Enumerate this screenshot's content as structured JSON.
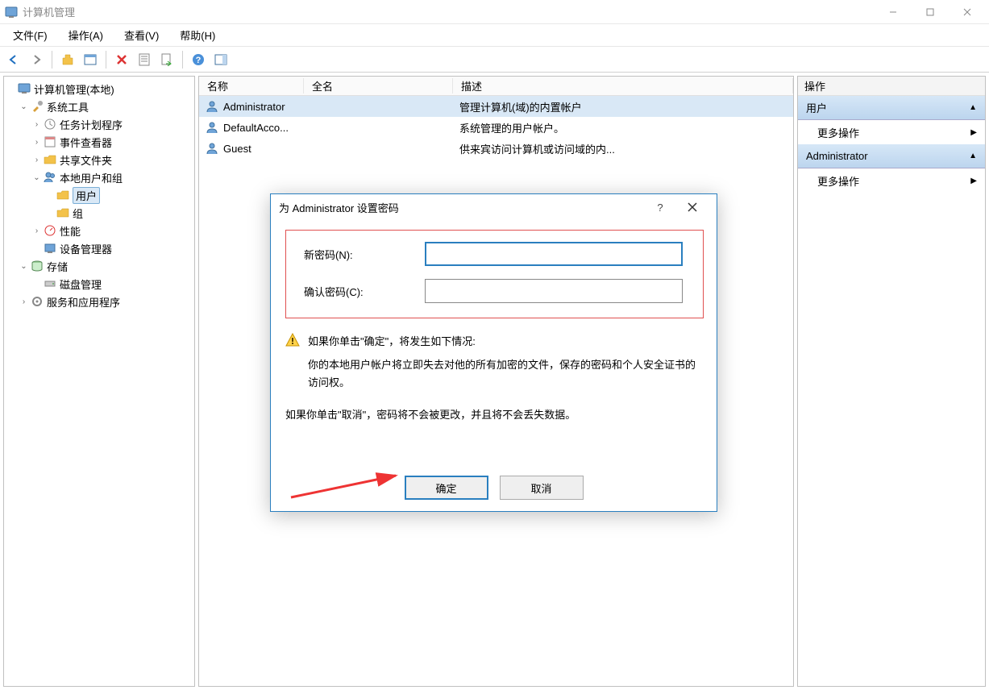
{
  "window": {
    "title": "计算机管理",
    "menu": {
      "file": "文件(F)",
      "action": "操作(A)",
      "view": "查看(V)",
      "help": "帮助(H)"
    }
  },
  "tree": {
    "root": "计算机管理(本地)",
    "system_tools": "系统工具",
    "task_scheduler": "任务计划程序",
    "event_viewer": "事件查看器",
    "shared_folders": "共享文件夹",
    "local_users": "本地用户和组",
    "users": "用户",
    "groups": "组",
    "performance": "性能",
    "device_mgr": "设备管理器",
    "storage": "存储",
    "disk_mgmt": "磁盘管理",
    "services": "服务和应用程序"
  },
  "list": {
    "headers": {
      "name": "名称",
      "full": "全名",
      "desc": "描述"
    },
    "rows": [
      {
        "name": "Administrator",
        "full": "",
        "desc": "管理计算机(域)的内置帐户"
      },
      {
        "name": "DefaultAcco...",
        "full": "",
        "desc": "系统管理的用户帐户。"
      },
      {
        "name": "Guest",
        "full": "",
        "desc": "供来宾访问计算机或访问域的内..."
      }
    ]
  },
  "actions": {
    "header": "操作",
    "section1": "用户",
    "link1": "更多操作",
    "section2": "Administrator",
    "link2": "更多操作"
  },
  "dialog": {
    "title": "为 Administrator 设置密码",
    "new_pw_label": "新密码(N):",
    "confirm_pw_label": "确认密码(C):",
    "new_pw_value": "",
    "confirm_pw_value": "",
    "warning_line": "如果你单击\"确定\"，将发生如下情况:",
    "warning_body": "你的本地用户帐户将立即失去对他的所有加密的文件，保存的密码和个人安全证书的访问权。",
    "cancel_info": "如果你单击\"取消\"，密码将不会被更改，并且将不会丢失数据。",
    "ok": "确定",
    "cancel": "取消"
  }
}
